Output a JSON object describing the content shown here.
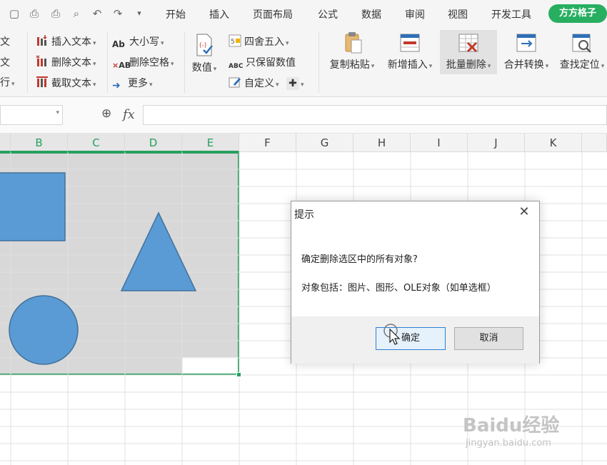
{
  "menu": {
    "items": [
      "开始",
      "插入",
      "页面布局",
      "公式",
      "数据",
      "审阅",
      "视图",
      "开发工具"
    ],
    "brand": "方方格子"
  },
  "ribbon": {
    "left_partial": [
      "文",
      "文",
      "行"
    ],
    "text_group": {
      "insert_text": "插入文本",
      "delete_text": "删除文本",
      "extract_text": "截取文本"
    },
    "case_group": {
      "case": "大小写",
      "delete_spaces": "删除空格",
      "more": "更多"
    },
    "number_group": {
      "value": "数值",
      "round": "四舍五入",
      "keep_values": "只保留数值",
      "custom": "自定义"
    },
    "big_buttons": {
      "copy_paste": "复制粘贴",
      "new_insert": "新增插入",
      "batch_delete": "批量删除",
      "merge_convert": "合并转换",
      "find_locate": "查找定位"
    }
  },
  "formula_bar": {
    "name_box": "",
    "fx_label": "fx",
    "formula": ""
  },
  "columns": [
    "B",
    "C",
    "D",
    "E",
    "F",
    "G",
    "H",
    "I",
    "J",
    "K"
  ],
  "selected_columns": [
    "B",
    "C",
    "D",
    "E"
  ],
  "dialog": {
    "title": "提示",
    "close_symbol": "✕",
    "message": "确定删除选区中的所有对象?",
    "detail": "对象包括：图片、图形、OLE对象（如单选框）",
    "ok_label": "确定",
    "cancel_label": "取消"
  },
  "watermark": {
    "brand": "Baidu经验",
    "url": "jingyan.baidu.com"
  },
  "colors": {
    "accent_green": "#27a060",
    "shape_fill": "#5b9bd5",
    "shape_stroke": "#41719c",
    "selection_fill": "#d8d8d8"
  }
}
